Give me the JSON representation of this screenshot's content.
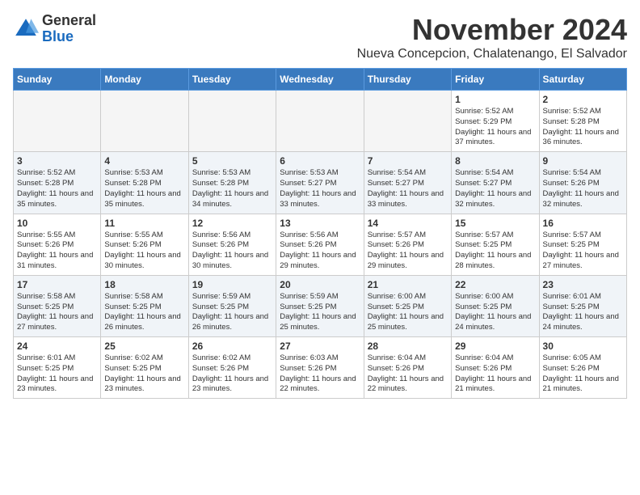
{
  "header": {
    "logo": {
      "general": "General",
      "blue": "Blue"
    },
    "month_title": "November 2024",
    "subtitle": "Nueva Concepcion, Chalatenango, El Salvador"
  },
  "weekdays": [
    "Sunday",
    "Monday",
    "Tuesday",
    "Wednesday",
    "Thursday",
    "Friday",
    "Saturday"
  ],
  "weeks": [
    [
      {
        "day": "",
        "info": ""
      },
      {
        "day": "",
        "info": ""
      },
      {
        "day": "",
        "info": ""
      },
      {
        "day": "",
        "info": ""
      },
      {
        "day": "",
        "info": ""
      },
      {
        "day": "1",
        "info": "Sunrise: 5:52 AM\nSunset: 5:29 PM\nDaylight: 11 hours and 37 minutes."
      },
      {
        "day": "2",
        "info": "Sunrise: 5:52 AM\nSunset: 5:28 PM\nDaylight: 11 hours and 36 minutes."
      }
    ],
    [
      {
        "day": "3",
        "info": "Sunrise: 5:52 AM\nSunset: 5:28 PM\nDaylight: 11 hours and 35 minutes."
      },
      {
        "day": "4",
        "info": "Sunrise: 5:53 AM\nSunset: 5:28 PM\nDaylight: 11 hours and 35 minutes."
      },
      {
        "day": "5",
        "info": "Sunrise: 5:53 AM\nSunset: 5:28 PM\nDaylight: 11 hours and 34 minutes."
      },
      {
        "day": "6",
        "info": "Sunrise: 5:53 AM\nSunset: 5:27 PM\nDaylight: 11 hours and 33 minutes."
      },
      {
        "day": "7",
        "info": "Sunrise: 5:54 AM\nSunset: 5:27 PM\nDaylight: 11 hours and 33 minutes."
      },
      {
        "day": "8",
        "info": "Sunrise: 5:54 AM\nSunset: 5:27 PM\nDaylight: 11 hours and 32 minutes."
      },
      {
        "day": "9",
        "info": "Sunrise: 5:54 AM\nSunset: 5:26 PM\nDaylight: 11 hours and 32 minutes."
      }
    ],
    [
      {
        "day": "10",
        "info": "Sunrise: 5:55 AM\nSunset: 5:26 PM\nDaylight: 11 hours and 31 minutes."
      },
      {
        "day": "11",
        "info": "Sunrise: 5:55 AM\nSunset: 5:26 PM\nDaylight: 11 hours and 30 minutes."
      },
      {
        "day": "12",
        "info": "Sunrise: 5:56 AM\nSunset: 5:26 PM\nDaylight: 11 hours and 30 minutes."
      },
      {
        "day": "13",
        "info": "Sunrise: 5:56 AM\nSunset: 5:26 PM\nDaylight: 11 hours and 29 minutes."
      },
      {
        "day": "14",
        "info": "Sunrise: 5:57 AM\nSunset: 5:26 PM\nDaylight: 11 hours and 29 minutes."
      },
      {
        "day": "15",
        "info": "Sunrise: 5:57 AM\nSunset: 5:25 PM\nDaylight: 11 hours and 28 minutes."
      },
      {
        "day": "16",
        "info": "Sunrise: 5:57 AM\nSunset: 5:25 PM\nDaylight: 11 hours and 27 minutes."
      }
    ],
    [
      {
        "day": "17",
        "info": "Sunrise: 5:58 AM\nSunset: 5:25 PM\nDaylight: 11 hours and 27 minutes."
      },
      {
        "day": "18",
        "info": "Sunrise: 5:58 AM\nSunset: 5:25 PM\nDaylight: 11 hours and 26 minutes."
      },
      {
        "day": "19",
        "info": "Sunrise: 5:59 AM\nSunset: 5:25 PM\nDaylight: 11 hours and 26 minutes."
      },
      {
        "day": "20",
        "info": "Sunrise: 5:59 AM\nSunset: 5:25 PM\nDaylight: 11 hours and 25 minutes."
      },
      {
        "day": "21",
        "info": "Sunrise: 6:00 AM\nSunset: 5:25 PM\nDaylight: 11 hours and 25 minutes."
      },
      {
        "day": "22",
        "info": "Sunrise: 6:00 AM\nSunset: 5:25 PM\nDaylight: 11 hours and 24 minutes."
      },
      {
        "day": "23",
        "info": "Sunrise: 6:01 AM\nSunset: 5:25 PM\nDaylight: 11 hours and 24 minutes."
      }
    ],
    [
      {
        "day": "24",
        "info": "Sunrise: 6:01 AM\nSunset: 5:25 PM\nDaylight: 11 hours and 23 minutes."
      },
      {
        "day": "25",
        "info": "Sunrise: 6:02 AM\nSunset: 5:25 PM\nDaylight: 11 hours and 23 minutes."
      },
      {
        "day": "26",
        "info": "Sunrise: 6:02 AM\nSunset: 5:26 PM\nDaylight: 11 hours and 23 minutes."
      },
      {
        "day": "27",
        "info": "Sunrise: 6:03 AM\nSunset: 5:26 PM\nDaylight: 11 hours and 22 minutes."
      },
      {
        "day": "28",
        "info": "Sunrise: 6:04 AM\nSunset: 5:26 PM\nDaylight: 11 hours and 22 minutes."
      },
      {
        "day": "29",
        "info": "Sunrise: 6:04 AM\nSunset: 5:26 PM\nDaylight: 11 hours and 21 minutes."
      },
      {
        "day": "30",
        "info": "Sunrise: 6:05 AM\nSunset: 5:26 PM\nDaylight: 11 hours and 21 minutes."
      }
    ]
  ]
}
